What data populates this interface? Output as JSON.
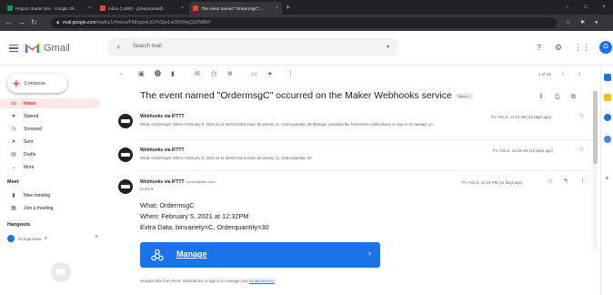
{
  "browser": {
    "tabs": [
      {
        "title": "Project charter.xlsx - Google Sh...",
        "fav_color": "#0f9d58",
        "active": false
      },
      {
        "title": "Inbox (1,889) - gchapmanw@...",
        "fav_color": "#ea4335",
        "active": false
      },
      {
        "title": "The event named \"OrdermsgC\"...",
        "fav_color": "#ea4335",
        "active": true
      }
    ],
    "close_glyph": "×",
    "new_tab_glyph": "+",
    "window_controls": [
      "–",
      "□",
      "×"
    ],
    "url_host": "mail.google.com",
    "url_path": "/mail/u/1/#inbox/FMfcgxwLtGYhSpsLwZBSWqQ3ZNBfrR",
    "nav_icons": [
      "arrow-left-icon",
      "arrow-right-icon",
      "reload-icon",
      "lock-icon",
      "star-icon",
      "puzzle-icon"
    ]
  },
  "gmail": {
    "app_name": "Gmail",
    "search_placeholder": "Search mail",
    "header_icons": [
      "help-icon",
      "settings-icon",
      "apps-icon"
    ],
    "avatar_letter": "G"
  },
  "sidebar": {
    "compose_label": "Compose",
    "items": [
      {
        "label": "Inbox",
        "icon": "▭",
        "active": true
      },
      {
        "label": "Starred",
        "icon": "★",
        "active": false
      },
      {
        "label": "Snoozed",
        "icon": "◷",
        "active": false
      },
      {
        "label": "Sent",
        "icon": "➤",
        "active": false
      },
      {
        "label": "Drafts",
        "icon": "▤",
        "active": false
      },
      {
        "label": "More",
        "icon": "⌄",
        "active": false
      }
    ],
    "meet_title": "Meet",
    "meet_items": [
      {
        "label": "New meeting",
        "icon": "▮"
      },
      {
        "label": "Join a meeting",
        "icon": "▦"
      }
    ],
    "hangouts_title": "Hangouts",
    "hangouts_user": "Gchapmanw",
    "hangouts_add": "+"
  },
  "thread": {
    "subject": "The event named \"OrdermsgC\" occurred on the Maker Webhooks service",
    "label_badge": "Inbox ×",
    "pagination": "1 of 24",
    "messages": [
      {
        "sender": "Webhooks via IFTTT",
        "snippet": "What: OrdermsgC When: February 5, 2021 at 11:34AM Extra Data: binvariety=C, Orderquantity=30 Manage Unsubscribe from these notifications or sign in to manage yo",
        "date": "Fri, Feb 5, 11:34 AM (12 days ago)"
      },
      {
        "sender": "Webhooks via IFTTT",
        "snippet": "What: OrdermsgC When: February 5, 2021 at 11:45AM Extra Data: binvariety=C, Orderquantity=30",
        "date": "Fri, Feb 5, 11:46 AM (12 days ago)"
      },
      {
        "sender": "Webhooks via IFTTT",
        "sender_email": "<action@ifttt.com>",
        "to": "to me ▾",
        "date": "Fri, Feb 5, 12:32 PM (12 days ago)",
        "body": [
          "What: OrdermsgC",
          "When: February 5, 2021 at 12:32PM",
          "Extra Data: binvariety=C, Orderquantity=30"
        ],
        "manage_label": "Manage",
        "manage_arrow": "›",
        "unsubscribe_prefix": "Unsubscribe from these notifications or sign in to manage your ",
        "unsubscribe_link": "Email services",
        "unsubscribe_suffix": "."
      }
    ]
  },
  "colors": {
    "accent_blue": "#1a73e8",
    "gmail_red": "#ea4335",
    "chrome_dark": "#202124"
  }
}
